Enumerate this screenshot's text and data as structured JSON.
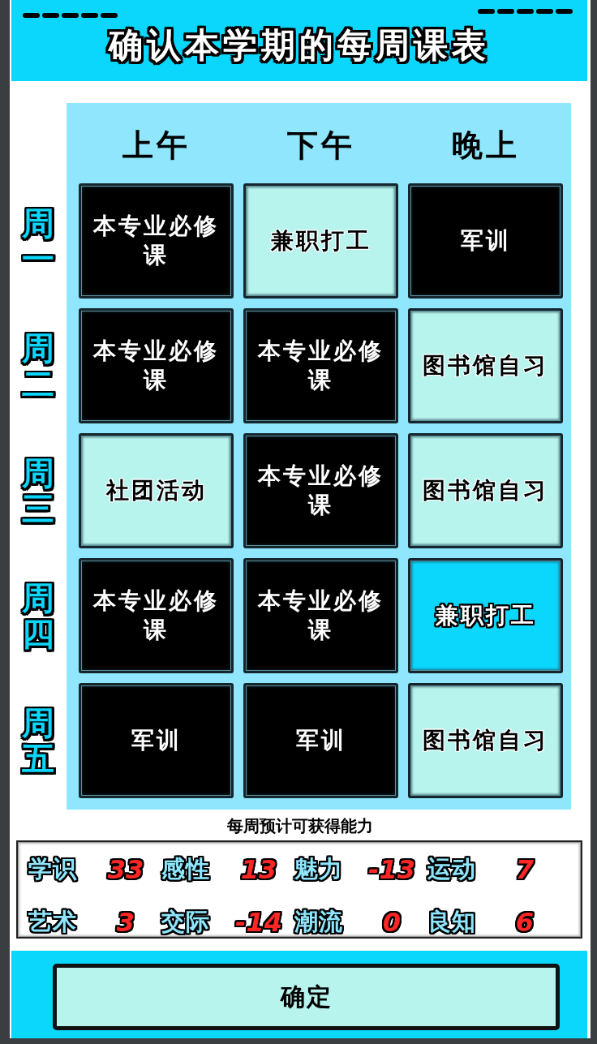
{
  "header": {
    "title": "确认本学期的每周课表"
  },
  "schedule": {
    "columns": [
      "上午",
      "下午",
      "晚上"
    ],
    "rows": [
      {
        "day": "周一",
        "cells": [
          {
            "label": "本专业必修课",
            "kind": "fixed",
            "selected": false
          },
          {
            "label": "兼职打工",
            "kind": "free",
            "selected": false
          },
          {
            "label": "军训",
            "kind": "fixed",
            "selected": false
          }
        ]
      },
      {
        "day": "周二",
        "cells": [
          {
            "label": "本专业必修课",
            "kind": "fixed",
            "selected": false
          },
          {
            "label": "本专业必修课",
            "kind": "fixed",
            "selected": false
          },
          {
            "label": "图书馆自习",
            "kind": "free",
            "selected": false
          }
        ]
      },
      {
        "day": "周三",
        "cells": [
          {
            "label": "社团活动",
            "kind": "free",
            "selected": false
          },
          {
            "label": "本专业必修课",
            "kind": "fixed",
            "selected": false
          },
          {
            "label": "图书馆自习",
            "kind": "free",
            "selected": false
          }
        ]
      },
      {
        "day": "周四",
        "cells": [
          {
            "label": "本专业必修课",
            "kind": "fixed",
            "selected": false
          },
          {
            "label": "本专业必修课",
            "kind": "fixed",
            "selected": false
          },
          {
            "label": "兼职打工",
            "kind": "free",
            "selected": true
          }
        ]
      },
      {
        "day": "周五",
        "cells": [
          {
            "label": "军训",
            "kind": "fixed",
            "selected": false
          },
          {
            "label": "军训",
            "kind": "fixed",
            "selected": false
          },
          {
            "label": "图书馆自习",
            "kind": "free",
            "selected": false
          }
        ]
      }
    ]
  },
  "abilities": {
    "title": "每周预计可获得能力",
    "stats": [
      {
        "name": "学识",
        "value": "33"
      },
      {
        "name": "感性",
        "value": "13"
      },
      {
        "name": "魅力",
        "value": "-13"
      },
      {
        "name": "运动",
        "value": "7"
      },
      {
        "name": "艺术",
        "value": "3"
      },
      {
        "name": "交际",
        "value": "-14"
      },
      {
        "name": "潮流",
        "value": "0"
      },
      {
        "name": "良知",
        "value": "6"
      }
    ]
  },
  "confirm_button": {
    "label": "确定"
  }
}
